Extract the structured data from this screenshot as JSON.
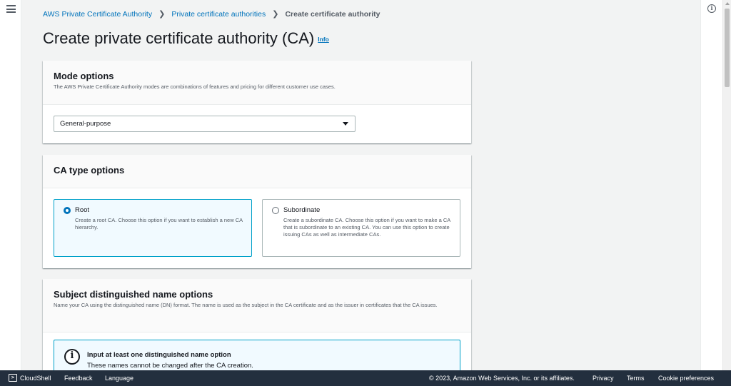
{
  "breadcrumbs": [
    {
      "label": "AWS Private Certificate Authority"
    },
    {
      "label": "Private certificate authorities"
    },
    {
      "label": "Create certificate authority"
    }
  ],
  "page": {
    "title": "Create private certificate authority (CA)",
    "info_label": "Info"
  },
  "mode_options": {
    "title": "Mode options",
    "description": "The AWS Private Certificate Authority modes are combinations of features and pricing for different customer use cases.",
    "selected": "General-purpose"
  },
  "ca_type_options": {
    "title": "CA type options",
    "tiles": [
      {
        "label": "Root",
        "description": "Create a root CA. Choose this option if you want to establish a new CA hierarchy.",
        "selected": true
      },
      {
        "label": "Subordinate",
        "description": "Create a subordinate CA. Choose this option if you want to make a CA that is subordinate to an existing CA. You can use this option to create issuing CAs as well as intermediate CAs.",
        "selected": false
      }
    ]
  },
  "dn_options": {
    "title": "Subject distinguished name options",
    "description": "Name your CA using the distinguished name (DN) format. The name is used as the subject in the CA certificate and as the issuer in certificates that the CA issues.",
    "alert_title": "Input at least one distinguished name option",
    "alert_text": "These names cannot be changed after the CA creation."
  },
  "footer": {
    "cloudshell": "CloudShell",
    "feedback": "Feedback",
    "language": "Language",
    "copyright": "© 2023, Amazon Web Services, Inc. or its affiliates.",
    "privacy": "Privacy",
    "terms": "Terms",
    "cookie": "Cookie preferences"
  },
  "icons": {
    "menu": "hamburger-icon",
    "help": "info-icon",
    "alert": "info-icon",
    "cloudshell": "terminal-icon"
  },
  "colors": {
    "link": "#0073bb",
    "selected_border": "#00a1c9",
    "selected_bg": "#f1faff",
    "footer_bg": "#232f3e"
  }
}
